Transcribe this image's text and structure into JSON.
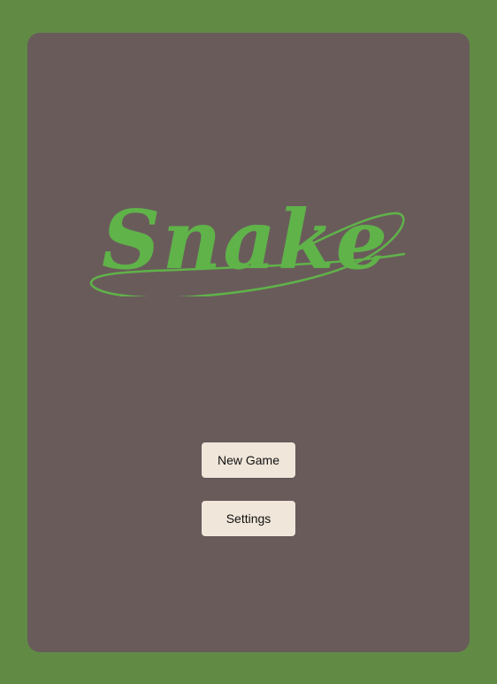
{
  "game": {
    "title": "Snake"
  },
  "menu": {
    "new_game_label": "New Game",
    "settings_label": "Settings"
  },
  "colors": {
    "background": "#618b45",
    "panel": "#6a5b5b",
    "logo": "#5fb349",
    "button": "#f0e6da"
  }
}
